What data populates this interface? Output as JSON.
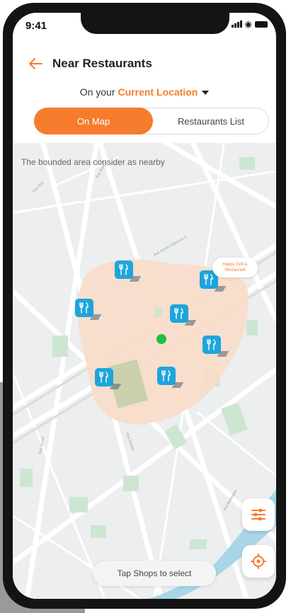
{
  "status_bar": {
    "time": "9:41"
  },
  "header": {
    "title": "Near Restaurants",
    "back_icon": "arrow-left-icon"
  },
  "location": {
    "prefix": "On your",
    "value": "Current Location"
  },
  "toggle": {
    "map_label": "On Map",
    "list_label": "Restaurants List",
    "active": "On Map"
  },
  "map": {
    "caption": "The bounded area consider as nearby",
    "bubble_label": "Happy Grill & Restaurant",
    "pin_icon": "fork-knife-icon",
    "pin_count": 7
  },
  "controls": {
    "filter_icon": "sliders-icon",
    "locate_icon": "target-icon",
    "tap_hint": "Tap Shops to select"
  },
  "colors": {
    "accent": "#f57c2c",
    "pin": "#1ea5dc",
    "user": "#1ec046",
    "area": "#f9dcc8"
  }
}
